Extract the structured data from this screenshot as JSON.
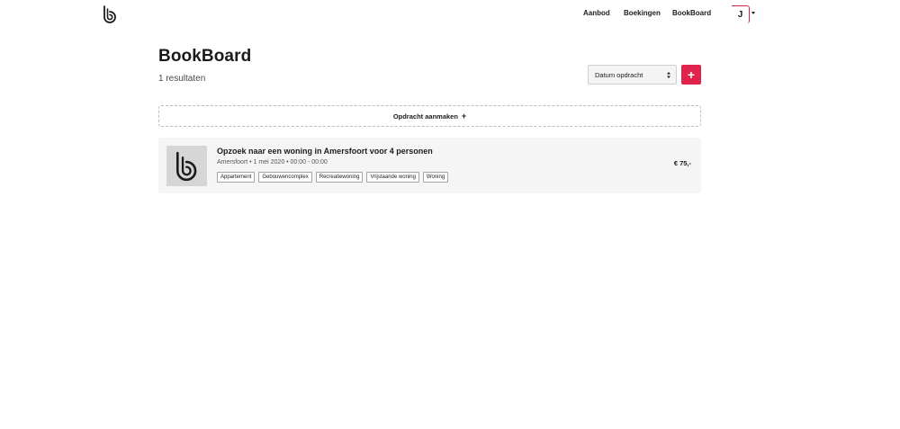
{
  "nav": {
    "items": [
      "Aanbod",
      "Boekingen",
      "BookBoard"
    ],
    "user_initial": "J"
  },
  "page": {
    "title": "BookBoard",
    "result_count": "1 resultaten"
  },
  "sort": {
    "selected": "Datum opdracht"
  },
  "create": {
    "label": "Opdracht aanmaken",
    "plus": "+"
  },
  "add_button": "+",
  "listings": [
    {
      "title": "Opzoek naar een woning in Amersfoort voor 4 personen",
      "meta": "Amersfoort • 1 mei 2020 • 00:00 - 00:00",
      "tags": [
        "Appartement",
        "Gebouwencomplex",
        "Recreatiewoning",
        "Vrijstaande woning",
        "Woning"
      ],
      "price": "€ 75,-"
    }
  ],
  "colors": {
    "accent": "#e0234a",
    "card_bg": "#f5f5f5",
    "thumb_bg": "#d6d6d6"
  }
}
